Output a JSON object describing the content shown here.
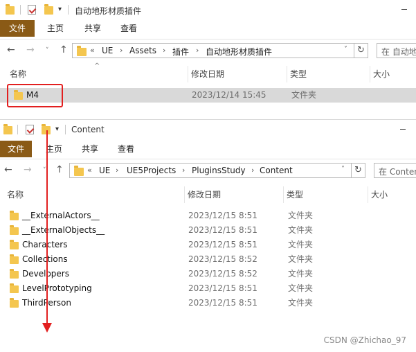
{
  "window1": {
    "title": "自动地形材质插件",
    "ribbon_tabs": [
      "文件",
      "主页",
      "共享",
      "查看"
    ],
    "breadcrumb": [
      "UE",
      "Assets",
      "插件",
      "自动地形材质插件"
    ],
    "breadcrumb_prefix": "«",
    "search_placeholder": "在 自动地形材质插件 中搜索",
    "columns": [
      "名称",
      "修改日期",
      "类型",
      "大小"
    ],
    "rows": [
      {
        "name": "M4",
        "date": "2023/12/14 15:45",
        "type": "文件夹",
        "size": ""
      }
    ]
  },
  "window2": {
    "title": "Content",
    "ribbon_tabs": [
      "文件",
      "主页",
      "共享",
      "查看"
    ],
    "breadcrumb": [
      "UE",
      "UE5Projects",
      "PluginsStudy",
      "Content"
    ],
    "breadcrumb_prefix": "«",
    "search_placeholder": "在 Content 中搜索",
    "columns": [
      "名称",
      "修改日期",
      "类型",
      "大小"
    ],
    "rows": [
      {
        "name": "__ExternalActors__",
        "date": "2023/12/15 8:51",
        "type": "文件夹"
      },
      {
        "name": "__ExternalObjects__",
        "date": "2023/12/15 8:51",
        "type": "文件夹"
      },
      {
        "name": "Characters",
        "date": "2023/12/15 8:51",
        "type": "文件夹"
      },
      {
        "name": "Collections",
        "date": "2023/12/15 8:52",
        "type": "文件夹"
      },
      {
        "name": "Developers",
        "date": "2023/12/15 8:52",
        "type": "文件夹"
      },
      {
        "name": "LevelPrototyping",
        "date": "2023/12/15 8:51",
        "type": "文件夹"
      },
      {
        "name": "ThirdPerson",
        "date": "2023/12/15 8:51",
        "type": "文件夹"
      }
    ]
  },
  "icons": {
    "back": "←",
    "forward": "→",
    "recent": "˅",
    "up": "↑",
    "refresh": "↻",
    "dropdown": "˅",
    "sort": "^",
    "pin": "▾"
  },
  "annotation": {
    "color": "#e21f1f"
  },
  "watermark": "CSDN @Zhichao_97"
}
